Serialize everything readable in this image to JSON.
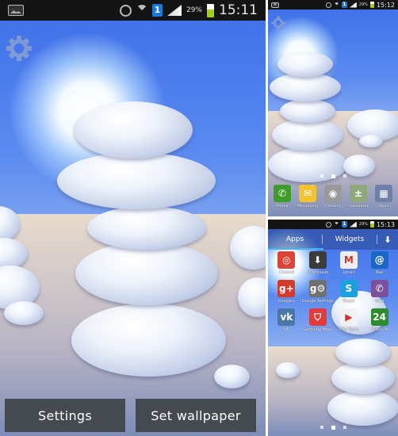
{
  "status_main": {
    "time": "15:11",
    "battery_percent": "29%",
    "notification_count": "1"
  },
  "status_home": {
    "time": "15:12",
    "battery_percent": "29%",
    "notification_count": "1"
  },
  "status_drawer": {
    "time": "15:13",
    "battery_percent": "29%",
    "notification_count": "1"
  },
  "preview": {
    "buttons": {
      "settings": "Settings",
      "set_wallpaper": "Set wallpaper"
    },
    "icons": {
      "settings": "gear-icon"
    }
  },
  "home": {
    "dock": [
      {
        "label": "Phone",
        "icon": "phone-icon",
        "glyph": "✆",
        "color": "#3e9c2a"
      },
      {
        "label": "Messaging",
        "icon": "message-icon",
        "glyph": "✉",
        "color": "#f2c230"
      },
      {
        "label": "Camera",
        "icon": "camera-icon",
        "glyph": "◉",
        "color": "#9a9a9a"
      },
      {
        "label": "Calculator",
        "icon": "calculator-icon",
        "glyph": "±",
        "color": "#8fa97a"
      },
      {
        "label": "Apps",
        "icon": "apps-grid-icon",
        "glyph": "▦",
        "color": "#6f7fa8"
      }
    ],
    "page_indicator": {
      "pages": 3,
      "current": 2
    }
  },
  "drawer": {
    "tabs": [
      {
        "label": "Apps",
        "active": true
      },
      {
        "label": "Widgets",
        "active": false
      }
    ],
    "download_icon": "download-icon",
    "apps": [
      {
        "label": "Chrome",
        "icon": "chrome-icon",
        "glyph": "◎",
        "color": "#db4437"
      },
      {
        "label": "Downloads",
        "icon": "downloads-icon",
        "glyph": "⬇",
        "color": "#3b3b3b"
      },
      {
        "label": "Gmail",
        "icon": "gmail-icon",
        "glyph": "M",
        "color": "#eeeeee"
      },
      {
        "label": "Mail",
        "icon": "mail-icon",
        "glyph": "@",
        "color": "#1b66c9"
      },
      {
        "label": "Google+",
        "icon": "google-plus-icon",
        "glyph": "g+",
        "color": "#d23a2a"
      },
      {
        "label": "Google Settings",
        "icon": "google-settings-icon",
        "glyph": "g⚙",
        "color": "#707070"
      },
      {
        "label": "Skype",
        "icon": "skype-icon",
        "glyph": "S",
        "color": "#1ba0e0"
      },
      {
        "label": "Viber",
        "icon": "viber-icon",
        "glyph": "✆",
        "color": "#7b519d"
      },
      {
        "label": "VK",
        "icon": "vk-icon",
        "glyph": "vk",
        "color": "#4a76a8"
      },
      {
        "label": "Samsung Apps",
        "icon": "samsung-apps-icon",
        "glyph": "⛉",
        "color": "#e33b3b"
      },
      {
        "label": "Play Store",
        "icon": "play-store-icon",
        "glyph": "▶",
        "color": "#f2f2f2"
      },
      {
        "label": "Privat24",
        "icon": "privat24-icon",
        "glyph": "24",
        "color": "#2e8b2e"
      }
    ],
    "page_indicator": {
      "pages": 3,
      "current": 2
    }
  }
}
